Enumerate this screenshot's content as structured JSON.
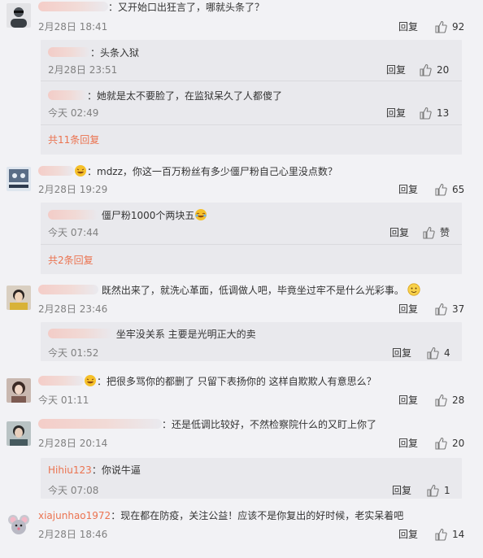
{
  "comments": [
    {
      "text": "：又开始口出狂言了，哪就头条了？",
      "time": "2月28日 18:41",
      "reply_label": "回复",
      "likes": "92",
      "subs": [
        {
          "text": "：头条入狱",
          "time": "2月28日 23:51",
          "reply_label": "回复",
          "likes": "20"
        },
        {
          "text": "：她就是太不要脸了，在监狱呆久了人都傻了",
          "time": "今天 02:49",
          "reply_label": "回复",
          "likes": "13"
        }
      ],
      "more": "共11条回复"
    },
    {
      "text": "：mdzz，你这一百万粉丝有多少僵尸粉自己心里没点数？",
      "time": "2月28日 19:29",
      "reply_label": "回复",
      "likes": "65",
      "subs": [
        {
          "text": "僵尸粉1000个两块五",
          "time": "今天 07:44",
          "reply_label": "回复",
          "likes": "赞"
        }
      ],
      "more": "共2条回复"
    },
    {
      "text": "既然出来了，就洗心革面，低调做人吧，毕竟坐过牢不是什么光彩事。",
      "time": "2月28日 23:46",
      "reply_label": "回复",
      "likes": "37",
      "subs": [
        {
          "text": "坐牢没关系 主要是光明正大的卖",
          "time": "今天 01:52",
          "reply_label": "回复",
          "likes": "4"
        }
      ]
    },
    {
      "text": "：把很多骂你的都删了 只留下表扬你的 这样自欺欺人有意思么？",
      "time": "今天 01:11",
      "reply_label": "回复",
      "likes": "28"
    },
    {
      "text": "：还是低调比较好，不然检察院什么的又盯上你了",
      "time": "2月28日 20:14",
      "reply_label": "回复",
      "likes": "20",
      "subs": [
        {
          "user": "Hihiu123",
          "text": "：你说牛逼",
          "time": "今天 07:08",
          "reply_label": "回复",
          "likes": "1"
        }
      ]
    },
    {
      "user": "xiajunhao1972",
      "text": "：现在都在防疫，关注公益！应该不是你复出的好时候，老实呆着吧",
      "time": "2月28日 18:46",
      "reply_label": "回复",
      "likes": "14"
    }
  ],
  "colors": {
    "username": "#eb7350",
    "link": "#eb7350",
    "background": "#f2f2f5",
    "subbox": "#e9e9ed"
  },
  "icons": {
    "like": "thumbs-up-icon",
    "laugh": "laughing-emoji",
    "smile": "smile-emoji"
  }
}
